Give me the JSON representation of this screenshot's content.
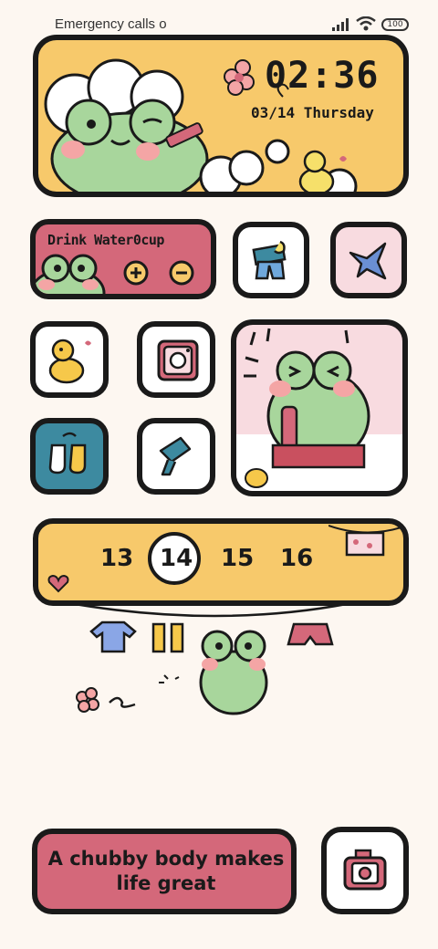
{
  "status_bar": {
    "carrier_text": "Emergency calls o",
    "battery": "100"
  },
  "clock_widget": {
    "time": "02:36",
    "date": "03/14 Thursday"
  },
  "water_widget": {
    "title": "Drink Water0cup",
    "plus_icon": "plus-icon",
    "minus_icon": "minus-icon"
  },
  "calendar_widget": {
    "days": [
      "13",
      "14",
      "15",
      "16"
    ],
    "selected_day": "14"
  },
  "quote_widget": {
    "text": "A chubby body makes life great"
  },
  "colors": {
    "background": "#fdf7f1",
    "yellow": "#f7c96b",
    "pink": "#d4687a",
    "frog_green": "#a8d69c",
    "teal": "#3d8aa0"
  },
  "icons": [
    "clothes-icon",
    "bird-icon",
    "duck-icon",
    "camera-icon",
    "socks-icon",
    "brush-icon",
    "camera-icon"
  ]
}
